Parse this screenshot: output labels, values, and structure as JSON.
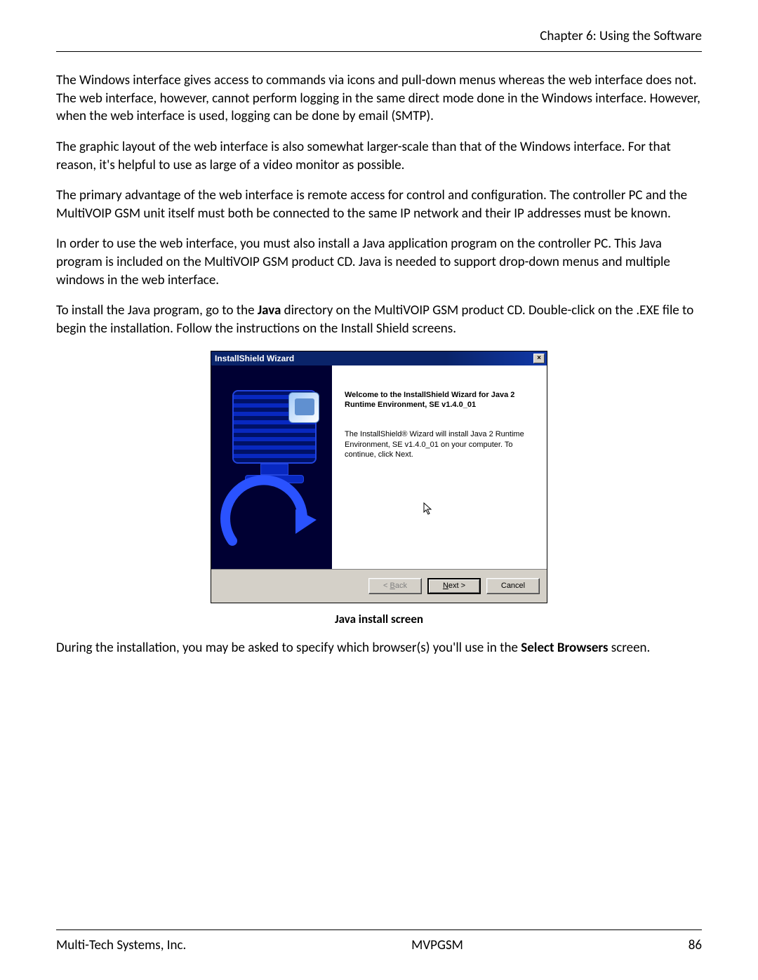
{
  "header": {
    "chapter": "Chapter 6: Using the Software"
  },
  "paragraphs": {
    "p1": "The Windows interface gives access to commands via icons and pull-down menus whereas the web interface does not. The web interface, however, cannot perform logging in the same direct mode done in the Windows interface. However, when the web interface is used, logging can be done by email (SMTP).",
    "p2": "The graphic layout of the web interface is also somewhat larger-scale than that of the  Windows interface.  For that reason, it's helpful to use as large of a video monitor as possible.",
    "p3": "The primary advantage of the web interface is remote access for control and configuration.  The controller PC and the MultiVOIP GSM unit itself must both be connected to the same IP network and their IP addresses must be known.",
    "p4": "In order to use the web interface, you must also install a Java application program on the controller PC.  This Java program is included on the MultiVOIP GSM product CD.  Java is needed to support drop-down menus and multiple windows in the web interface.",
    "p5_pre": "To install the Java program, go to the ",
    "p5_bold": "Java",
    "p5_post": " directory on the MultiVOIP GSM product CD.  Double-click on the .EXE file to begin the installation.  Follow the instructions on the Install Shield screens.",
    "p6_pre": "During the installation, you may be asked to specify which browser(s) you'll use in the ",
    "p6_bold": "Select Browsers",
    "p6_post": " screen."
  },
  "dialog": {
    "title": "InstallShield Wizard",
    "close_glyph": "×",
    "heading": "Welcome to the InstallShield Wizard for Java 2 Runtime Environment, SE v1.4.0_01",
    "body": "The InstallShield® Wizard will install Java 2 Runtime Environment, SE v1.4.0_01 on your computer.  To continue, click Next.",
    "buttons": {
      "back_lt": "<",
      "back_u": "B",
      "back_rest": "ack",
      "next_u": "N",
      "next_rest": "ext >",
      "cancel": "Cancel"
    }
  },
  "caption": "Java install screen",
  "footer": {
    "left": "Multi-Tech Systems, Inc.",
    "center": "MVPGSM",
    "right": "86"
  }
}
